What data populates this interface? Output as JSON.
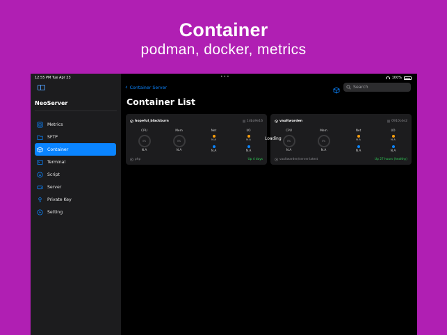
{
  "promo": {
    "title": "Container",
    "subtitle": "podman, docker, metrics"
  },
  "status_bar": {
    "time": "12:55 PM   Tue Apr 23",
    "battery": "100%"
  },
  "sidebar": {
    "app_title": "NeoServer",
    "items": [
      {
        "label": "Metrics",
        "icon": "metrics-icon",
        "active": false
      },
      {
        "label": "SFTP",
        "icon": "folder-icon",
        "active": false
      },
      {
        "label": "Container",
        "icon": "cube-icon",
        "active": true
      },
      {
        "label": "Terminal",
        "icon": "terminal-icon",
        "active": false
      },
      {
        "label": "Script",
        "icon": "script-icon",
        "active": false
      },
      {
        "label": "Server",
        "icon": "server-icon",
        "active": false
      },
      {
        "label": "Private Key",
        "icon": "key-icon",
        "active": false
      },
      {
        "label": "Setting",
        "icon": "gear-icon",
        "active": false
      }
    ]
  },
  "header": {
    "back_label": "Container Server",
    "search_placeholder": "Search",
    "page_title": "Container List",
    "loading_text": "Loading"
  },
  "containers": [
    {
      "name": "hopeful_blackburn",
      "id": "1dba9e16",
      "cpu_label": "CPU",
      "mem_label": "Mem",
      "net_label": "Net",
      "io_label": "I/O",
      "cpu_gauge": "0%",
      "mem_gauge": "0%",
      "cpu_value": "N.A",
      "mem_value": "N.A",
      "net_up": "N.A",
      "net_down": "N.A",
      "io_read": "N.A",
      "io_write": "N.A",
      "image": "php",
      "status": "Up 4 days"
    },
    {
      "name": "vaultwarden",
      "id": "0910cde2",
      "cpu_label": "CPU",
      "mem_label": "Mem",
      "net_label": "Net",
      "io_label": "I/O",
      "cpu_gauge": "0%",
      "mem_gauge": "0%",
      "cpu_value": "N.A",
      "mem_value": "N.A",
      "net_up": "N.A",
      "net_down": "N.A",
      "io_read": "N.A",
      "io_write": "N.A",
      "image": "vaultwarden/server:latest",
      "status": "Up 27 hours (healthy)"
    }
  ],
  "colors": {
    "background": "#b01fb3",
    "accent": "#0a84ff",
    "status_ok": "#30d158",
    "upload_dot": "#ff9f0a"
  }
}
